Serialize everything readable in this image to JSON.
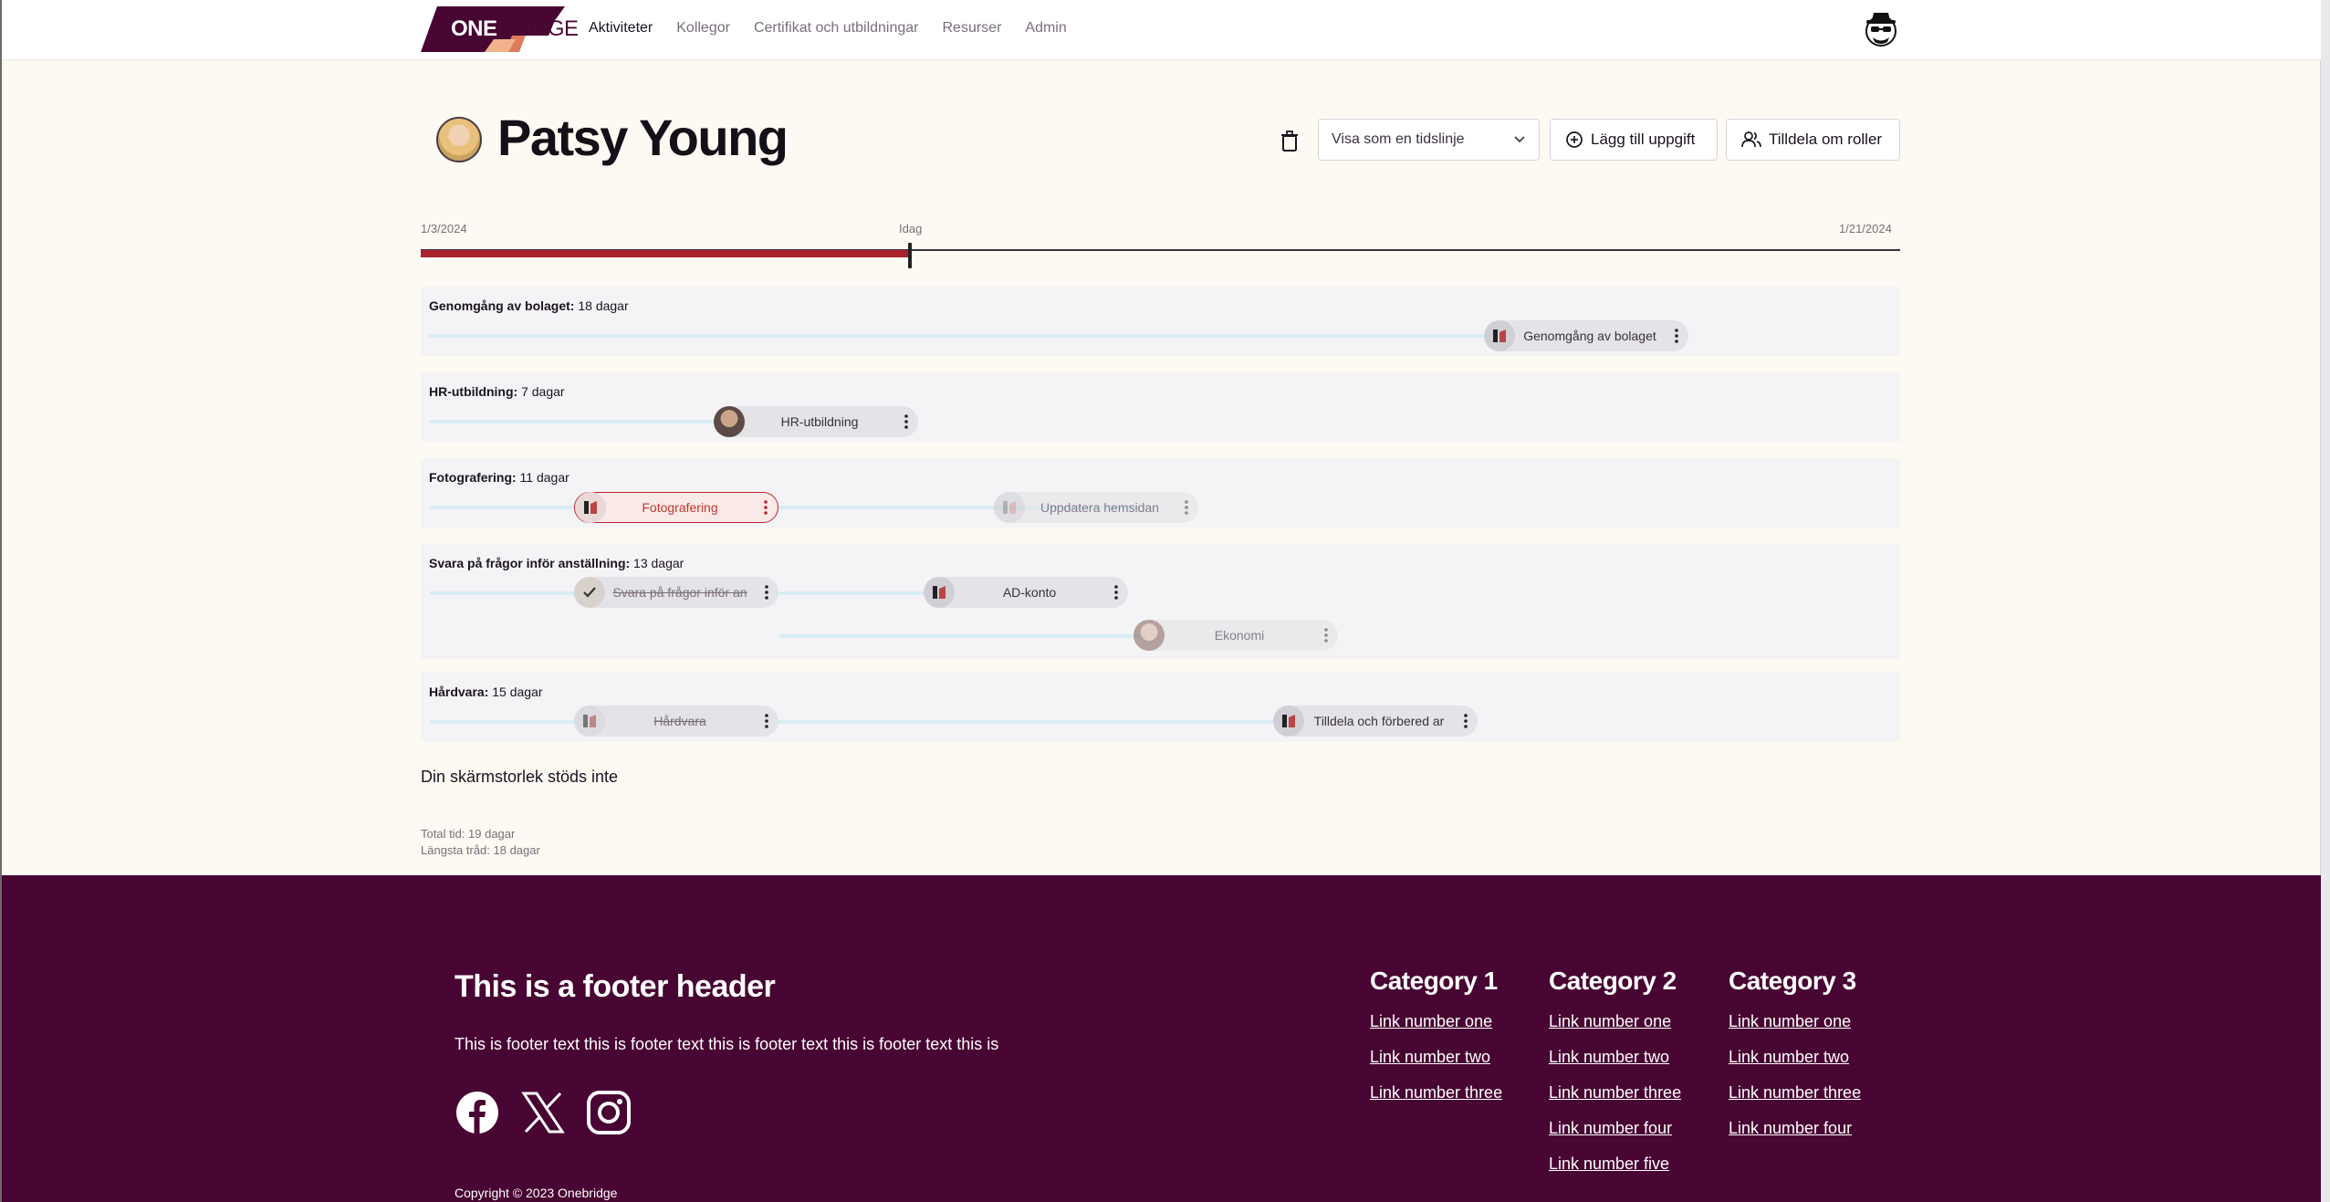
{
  "header": {
    "logo_bold": "ONE",
    "logo_light": "BRIDGE",
    "nav": [
      {
        "label": "Aktiviteter",
        "active": true
      },
      {
        "label": "Kollegor"
      },
      {
        "label": "Certifikat och utbildningar"
      },
      {
        "label": "Resurser"
      },
      {
        "label": "Admin"
      }
    ],
    "user_icon": "spy-hat-icon"
  },
  "page": {
    "title": "Patsy Young",
    "view_select": "Visa som en tidslinje",
    "add_task_label": "Lägg till uppgift",
    "reassign_label": "Tilldela om roller"
  },
  "timeline": {
    "start_label": "1/3/2024",
    "today_label": "Idag",
    "end_label": "1/21/2024",
    "progress_fraction": 0.33
  },
  "lanes": [
    {
      "name": "Genomgång av bolaget:",
      "duration": "18 dagar",
      "tasks": [
        {
          "label": "Genomgång av bolaget",
          "state": "normal"
        }
      ]
    },
    {
      "name": "HR-utbildning:",
      "duration": "7 dagar",
      "tasks": [
        {
          "label": "HR-utbildning",
          "state": "normal"
        }
      ]
    },
    {
      "name": "Fotografering:",
      "duration": "11 dagar",
      "tasks": [
        {
          "label": "Fotografering",
          "state": "active"
        },
        {
          "label": "Uppdatera hemsidan",
          "state": "faded"
        }
      ]
    },
    {
      "name": "Svara på frågor inför anställning:",
      "duration": "13 dagar",
      "tasks": [
        {
          "label": "Svara på frågor inför an",
          "state": "done"
        },
        {
          "label": "AD-konto",
          "state": "normal"
        },
        {
          "label": "Ekonomi",
          "state": "faded"
        }
      ]
    },
    {
      "name": "Hårdvara:",
      "duration": "15 dagar",
      "tasks": [
        {
          "label": "Hårdvara",
          "state": "done"
        },
        {
          "label": "Tilldela och förbered ar",
          "state": "normal"
        }
      ]
    }
  ],
  "notice": "Din skärmstorlek stöds inte",
  "stats": {
    "total": "Total tid: 19 dagar",
    "longest": "Längsta tråd: 18 dagar"
  },
  "footer": {
    "header": "This is a footer header",
    "text": "This is footer text this is footer text this is footer text this is footer text this is",
    "social": [
      "facebook-icon",
      "x-icon",
      "instagram-icon"
    ],
    "copyright": "Copyright © 2023 Onebridge",
    "columns": [
      {
        "title": "Category 1",
        "links": [
          "Link number one",
          "Link number two",
          "Link number three"
        ]
      },
      {
        "title": "Category 2",
        "links": [
          "Link number one",
          "Link number two",
          "Link number three",
          "Link number four",
          "Link number five"
        ]
      },
      {
        "title": "Category 3",
        "links": [
          "Link number one",
          "Link number two",
          "Link number three",
          "Link number four"
        ]
      }
    ]
  },
  "colors": {
    "brand": "#480432",
    "accent": "#a8212b",
    "background": "#fdfaf3"
  }
}
